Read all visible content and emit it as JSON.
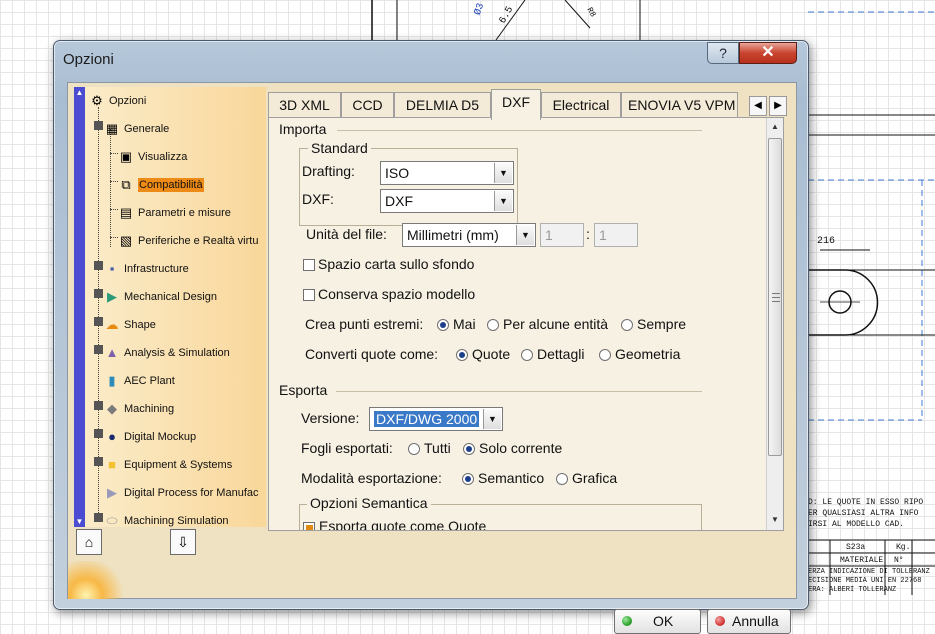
{
  "window": {
    "title": "Opzioni",
    "help_glyph": "?",
    "close_glyph": "✕"
  },
  "background": {
    "dimension_label": "216",
    "label_r8": "R8",
    "label_65": "6.5",
    "label_03": "Ø3",
    "note_lines": [
      "D: LE QUOTE IN ESSO RIPO",
      "ER QUALSIASI ALTRA INFO",
      "IRSI AL MODELLO CAD."
    ],
    "table_cells": [
      "S23a",
      "Kg.",
      "MATERIALE",
      "N°"
    ],
    "table_rows": [
      "ERZA INDICAZIONE DI TOLLERANZ",
      "ECISIONE MEDIA UNI EN 22768",
      "ERA: ALBERI TOLLERANZ"
    ]
  },
  "tree": {
    "items": [
      {
        "label": "Opzioni",
        "icon": "options-root-icon"
      },
      {
        "label": "Generale",
        "icon": "general-icon"
      },
      {
        "label": "Visualizza",
        "icon": "display-icon"
      },
      {
        "label": "Compatibilità",
        "icon": "compatibility-icon"
      },
      {
        "label": "Parametri e misure",
        "icon": "parameters-icon"
      },
      {
        "label": "Periferiche e Realtà virtu",
        "icon": "devices-icon"
      },
      {
        "label": "Infrastructure",
        "icon": "infrastructure-icon"
      },
      {
        "label": "Mechanical Design",
        "icon": "mechanical-design-icon"
      },
      {
        "label": "Shape",
        "icon": "shape-icon"
      },
      {
        "label": "Analysis & Simulation",
        "icon": "analysis-icon"
      },
      {
        "label": "AEC Plant",
        "icon": "aec-plant-icon"
      },
      {
        "label": "Machining",
        "icon": "machining-icon"
      },
      {
        "label": "Digital Mockup",
        "icon": "digital-mockup-icon"
      },
      {
        "label": "Equipment & Systems",
        "icon": "equipment-icon"
      },
      {
        "label": "Digital Process for Manufac",
        "icon": "digital-process-icon"
      },
      {
        "label": "Machining Simulation",
        "icon": "machining-simulation-icon"
      }
    ]
  },
  "tabs": [
    {
      "label": "3D XML"
    },
    {
      "label": "CCD"
    },
    {
      "label": "DELMIA D5"
    },
    {
      "label": "DXF"
    },
    {
      "label": "Electrical"
    },
    {
      "label": "ENOVIA V5 VPM"
    }
  ],
  "importa": {
    "title": "Importa",
    "standard": {
      "title": "Standard",
      "drafting_label": "Drafting:",
      "drafting_value": "ISO",
      "dxf_label": "DXF:",
      "dxf_value": "DXF"
    },
    "units_label": "Unità del file:",
    "units_value": "Millimetri (mm)",
    "units_num1": "1",
    "units_sep": ":",
    "units_num2": "1",
    "spazio_carta": "Spazio carta sullo sfondo",
    "conserva_spazio": "Conserva spazio modello",
    "punti_label": "Crea punti estremi:",
    "punti_options": [
      "Mai",
      "Per alcune entità",
      "Sempre"
    ],
    "quote_label": "Converti quote come:",
    "quote_options": [
      "Quote",
      "Dettagli",
      "Geometria"
    ]
  },
  "esporta": {
    "title": "Esporta",
    "versione_label": "Versione:",
    "versione_value": "DXF/DWG 2000",
    "fogli_label": "Fogli esportati:",
    "fogli_options": [
      "Tutti",
      "Solo corrente"
    ],
    "modalita_label": "Modalità esportazione:",
    "modalita_options": [
      "Semantico",
      "Grafica"
    ],
    "semantica_title": "Opzioni Semantica",
    "esporta_quote": "Esporta quote come Quote"
  },
  "buttons": {
    "ok": "OK",
    "cancel": "Annulla"
  },
  "colors": {
    "selection": "#ee8a16",
    "tree_scroll": "#4c4cd2",
    "ok_led": "#2fa52f",
    "cancel_led": "#d63a3a"
  }
}
